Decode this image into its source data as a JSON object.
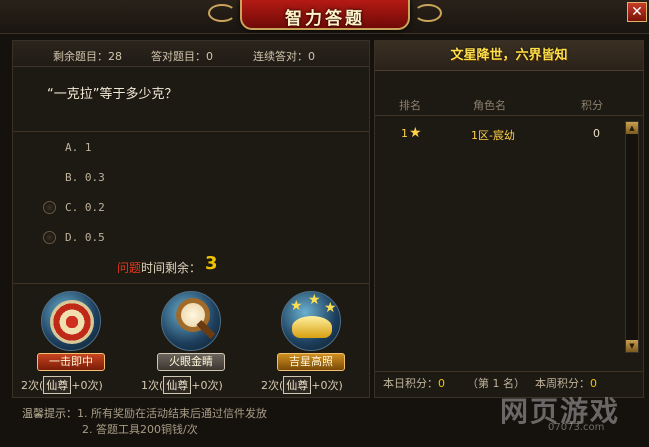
{
  "window": {
    "title": "智力答题",
    "close_icon": "close-icon"
  },
  "stats": {
    "remaining_label": "剩余题目：28",
    "correct_label": "答对题目：0",
    "streak_label": "连续答对：0"
  },
  "question": {
    "text": "“一克拉”等于多少克？",
    "options": [
      "A. 1",
      "B. 0.3",
      "C. 0.2",
      "D. 0.5"
    ]
  },
  "timer": {
    "red_part": "问题",
    "rest": "时间剩余：",
    "value": "3"
  },
  "tools": [
    {
      "label": "一击即中",
      "count": "2次(",
      "box": "仙尊",
      "extra": "+0次)"
    },
    {
      "label": "火眼金睛",
      "count": "1次(",
      "box": "仙尊",
      "extra": "+0次)"
    },
    {
      "label": "吉星高照",
      "count": "2次(",
      "box": "仙尊",
      "extra": "+0次)"
    }
  ],
  "tips": {
    "label": "温馨提示：",
    "line1": "1. 所有奖励在活动结束后通过信件发放",
    "line2": "2. 答题工具200铜钱/次"
  },
  "ranking": {
    "banner": "文星降世，六界皆知",
    "headers": [
      "排名",
      "角色名",
      "积分"
    ],
    "rows": [
      {
        "rank": "1",
        "name": "1区-宸幼",
        "points": "0"
      }
    ]
  },
  "scores": {
    "today_label": "本日积分：",
    "today_value": "0",
    "rank_label": "（第 1 名）",
    "week_label": "本周积分：",
    "week_value": "0"
  },
  "watermark": {
    "main": "网页游戏",
    "sub": "07073.com"
  }
}
